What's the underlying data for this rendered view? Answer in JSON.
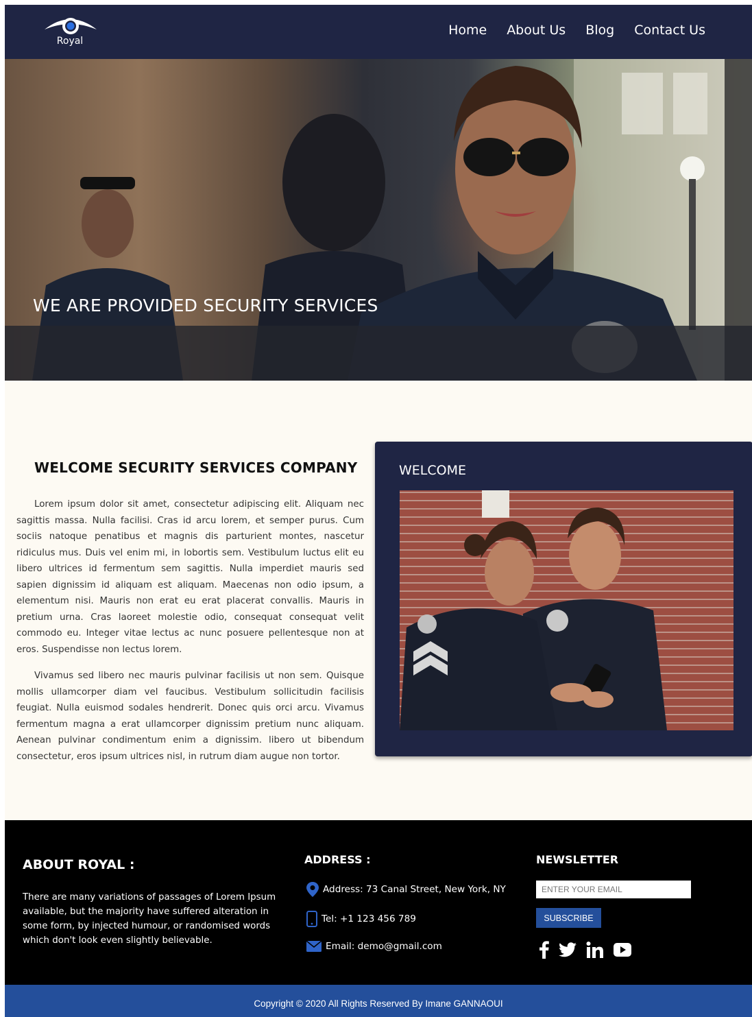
{
  "brand": {
    "logo_text": "Royal",
    "logo_icon": "eye-icon"
  },
  "nav": {
    "items": [
      {
        "label": "Home"
      },
      {
        "label": "About Us"
      },
      {
        "label": "Blog"
      },
      {
        "label": "Contact Us"
      }
    ]
  },
  "hero": {
    "title": "WE ARE PROVIDED SECURITY SERVICES"
  },
  "welcome": {
    "heading": "WELCOME SECURITY SERVICES COMPANY",
    "paragraphs": [
      "Lorem ipsum dolor sit amet, consectetur adipiscing elit. Aliquam nec sagittis massa. Nulla facilisi. Cras id arcu lorem, et semper purus. Cum sociis natoque penatibus et magnis dis parturient montes, nascetur ridiculus mus. Duis vel enim mi, in lobortis sem. Vestibulum luctus elit eu libero ultrices id fermentum sem sagittis. Nulla imperdiet mauris sed sapien dignissim id aliquam est aliquam. Maecenas non odio ipsum, a elementum nisi. Mauris non erat eu erat placerat convallis. Mauris in pretium urna. Cras laoreet molestie odio, consequat consequat velit commodo eu. Integer vitae lectus ac nunc posuere pellentesque non at eros. Suspendisse non lectus lorem.",
      "Vivamus sed libero nec mauris pulvinar facilisis ut non sem. Quisque mollis ullamcorper diam vel faucibus. Vestibulum sollicitudin facilisis feugiat. Nulla euismod sodales hendrerit. Donec quis orci arcu. Vivamus fermentum magna a erat ullamcorper dignissim pretium nunc aliquam. Aenean pulvinar condimentum enim a dignissim. libero ut bibendum consectetur, eros ipsum ultrices nisl, in rutrum diam augue non tortor."
    ],
    "card_title": "WELCOME"
  },
  "footer": {
    "about_title": "ABOUT ROYAL :",
    "about_text": "There are many variations of passages of Lorem Ipsum available, but the majority have suffered alteration in some form, by injected humour, or randomised words which don't look even slightly believable.",
    "address_title": "ADDRESS :",
    "address": "Address: 73 Canal Street, New York, NY",
    "tel": "Tel: +1 123 456 789",
    "email": "Email: demo@gmail.com",
    "newsletter_title": "NEWSLETTER",
    "email_placeholder": "ENTER YOUR EMAIL",
    "subscribe_label": "SUBSCRIBE",
    "socials": [
      "facebook-icon",
      "twitter-icon",
      "linkedin-icon",
      "youtube-icon"
    ],
    "copyright": "Copyright © 2020 All Rights Reserved By Imane GANNAOUI"
  },
  "colors": {
    "navy": "#1f2544",
    "blue": "#244f9b",
    "cream": "#fdfaf3",
    "black": "#000000"
  }
}
